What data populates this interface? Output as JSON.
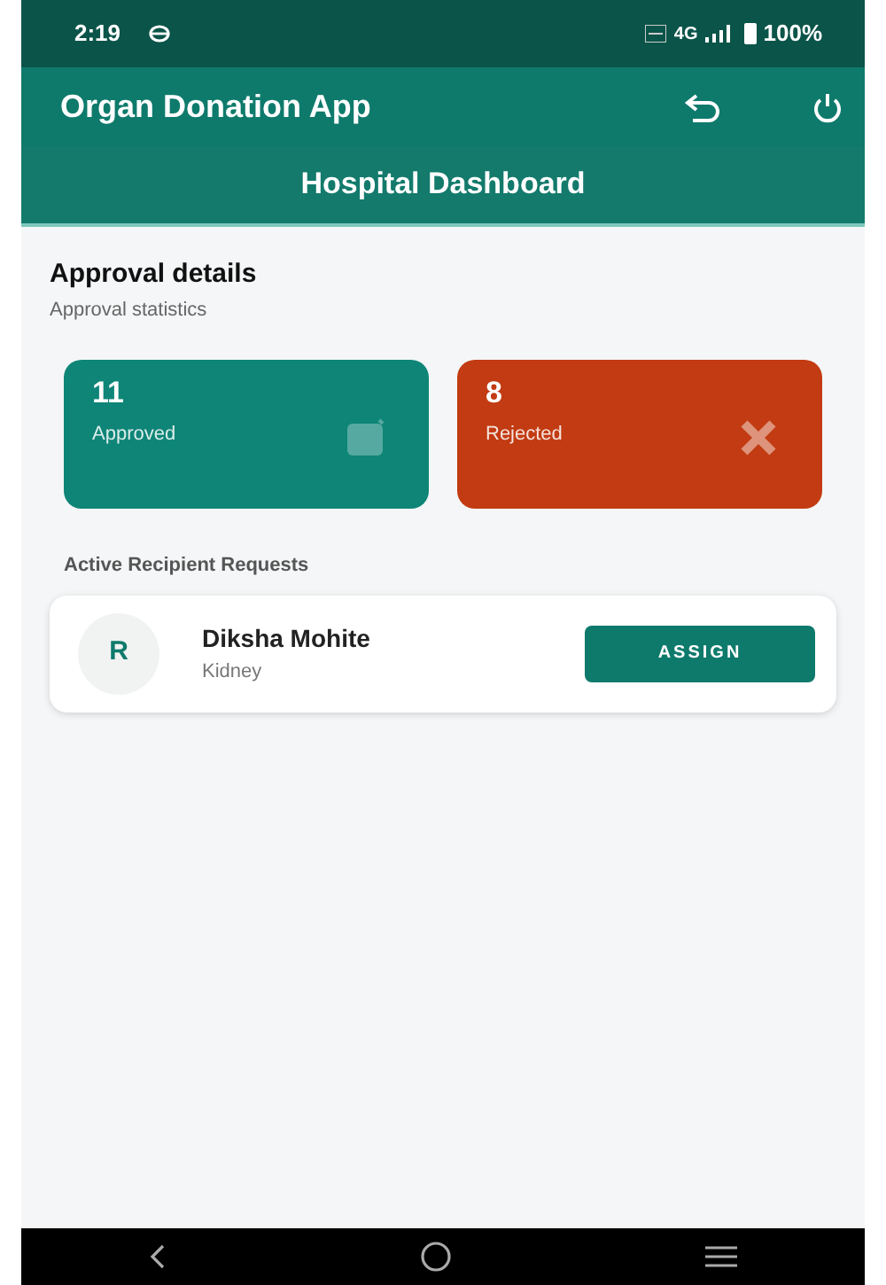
{
  "status_bar": {
    "time": "2:19",
    "network": "4G",
    "battery": "100%"
  },
  "app_bar": {
    "title": "Organ Donation App"
  },
  "header": {
    "title": "Hospital Dashboard"
  },
  "section": {
    "title": "Approval details",
    "subtitle": "Approval statistics"
  },
  "stats": [
    {
      "kind": "approved",
      "count": "11",
      "label": "Approved",
      "color": "#0e8577"
    },
    {
      "kind": "rejected",
      "count": "8",
      "label": "Rejected",
      "color": "#c23b12"
    }
  ],
  "requests": {
    "title": "Active Recipient Requests",
    "items": [
      {
        "initial": "R",
        "name": "Diksha Mohite",
        "organ": "Kidney",
        "action": "ASSIGN"
      }
    ]
  }
}
